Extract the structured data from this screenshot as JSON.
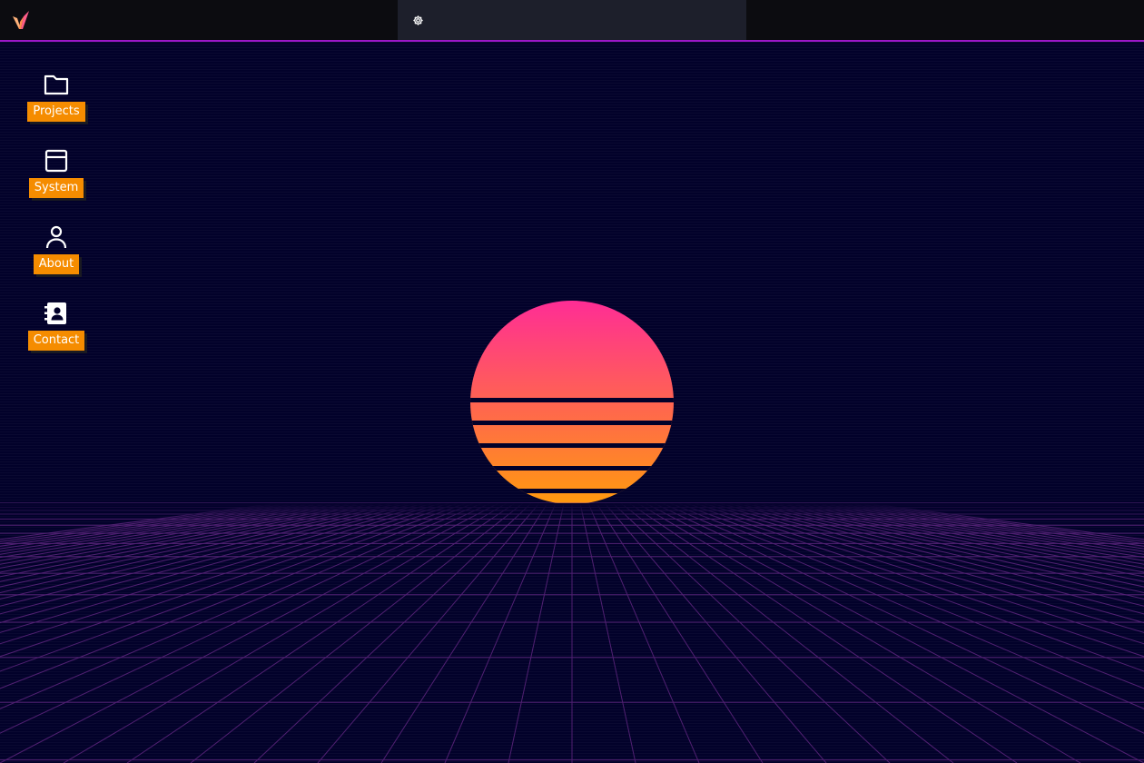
{
  "topbar": {
    "logo_icon": "brand-logo-icon",
    "task_strip_icon": "settings-gear-icon"
  },
  "desktop": {
    "icons": [
      {
        "label": "Projects",
        "icon": "folder-icon"
      },
      {
        "label": "System",
        "icon": "window-icon"
      },
      {
        "label": "About",
        "icon": "user-icon"
      },
      {
        "label": "Contact",
        "icon": "address-book-icon"
      }
    ]
  },
  "colors": {
    "accent_border": "#9b17c8",
    "label_bg": "#f58c00",
    "background": "#02012a",
    "sun_top": "#ff2d95",
    "sun_bottom": "#ff9a0e",
    "grid": "#6a2a8a"
  }
}
